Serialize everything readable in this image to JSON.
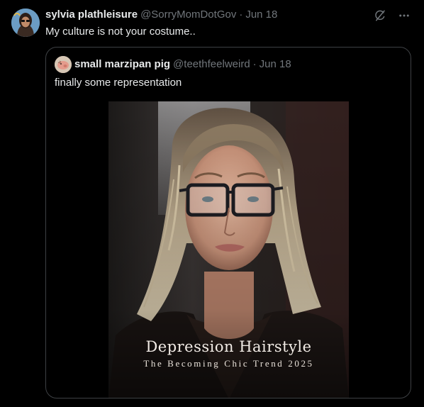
{
  "tweet": {
    "author_name": "sylvia plathleisure",
    "author_handle": "@SorryMomDotGov",
    "separator": "·",
    "time": "Jun 18",
    "text": "My culture is not your costume..",
    "icons": [
      "grok-icon",
      "more-icon"
    ]
  },
  "quoted": {
    "author_name": "small marzipan pig",
    "author_handle": "@teethfeelweird",
    "separator": "·",
    "time": "Jun 18",
    "text": "finally some representation",
    "media": {
      "caption_title": "Depression Hairstyle",
      "caption_subtitle": "The Becoming Chic Trend 2025"
    }
  },
  "colors": {
    "background": "#000000",
    "primary_text": "#e7e9ea",
    "secondary_text": "#71767b",
    "border": "#3e4144"
  }
}
